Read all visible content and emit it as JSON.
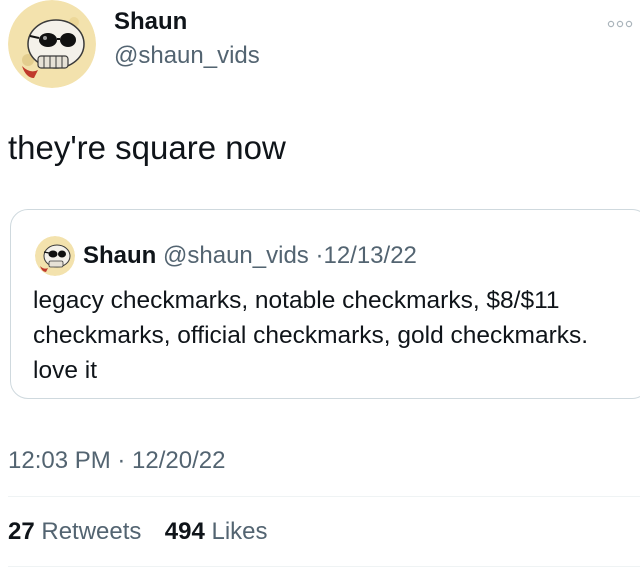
{
  "author": {
    "display_name": "Shaun",
    "handle": "@shaun_vids"
  },
  "tweet": {
    "text": "they're square now",
    "timestamp": "12:03 PM · 12/20/22"
  },
  "quoted": {
    "display_name": "Shaun",
    "handle": "@shaun_vids",
    "separator": "·",
    "date": "12/13/22",
    "text": "legacy checkmarks, notable checkmarks, $8/$11 checkmarks, official checkmarks, gold checkmarks. love it"
  },
  "stats": {
    "retweets_count": "27",
    "retweets_label": "Retweets",
    "likes_count": "494",
    "likes_label": "Likes"
  },
  "icons": {
    "avatar": "skull-with-sunglasses-avatar",
    "more": "more-options-icon"
  },
  "colors": {
    "text": "#0f1419",
    "secondary": "#536471",
    "border": "#cfd9de",
    "avatar_bg": "#f3e2ad"
  }
}
